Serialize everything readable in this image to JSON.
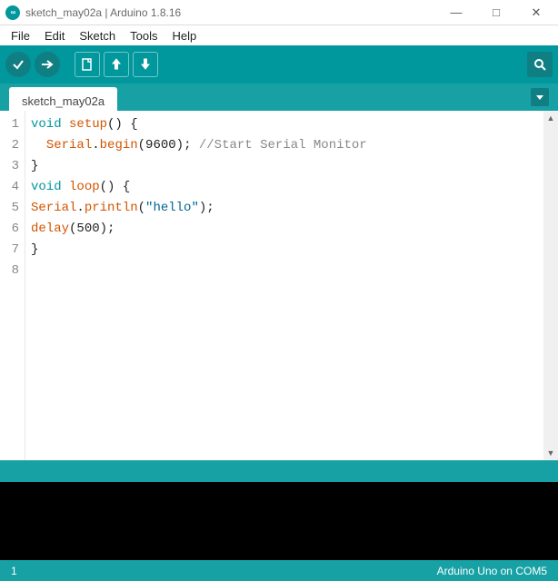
{
  "titlebar": {
    "text": "sketch_may02a | Arduino 1.8.16",
    "icon_text": "∞"
  },
  "window_buttons": {
    "min": "—",
    "max": "□",
    "close": "✕"
  },
  "menubar": [
    "File",
    "Edit",
    "Sketch",
    "Tools",
    "Help"
  ],
  "tab": {
    "label": "sketch_may02a"
  },
  "code": {
    "lines": [
      {
        "n": 1,
        "tokens": [
          {
            "t": "void",
            "c": "kw"
          },
          {
            "t": " "
          },
          {
            "t": "setup",
            "c": "fn"
          },
          {
            "t": "() {"
          }
        ]
      },
      {
        "n": 2,
        "tokens": [
          {
            "t": "  "
          },
          {
            "t": "Serial",
            "c": "fn"
          },
          {
            "t": "."
          },
          {
            "t": "begin",
            "c": "fn"
          },
          {
            "t": "(9600); "
          },
          {
            "t": "//Start Serial Monitor",
            "c": "cm"
          }
        ]
      },
      {
        "n": 3,
        "tokens": [
          {
            "t": "}"
          }
        ]
      },
      {
        "n": 4,
        "tokens": [
          {
            "t": ""
          }
        ]
      },
      {
        "n": 5,
        "tokens": [
          {
            "t": "void",
            "c": "kw"
          },
          {
            "t": " "
          },
          {
            "t": "loop",
            "c": "fn"
          },
          {
            "t": "() {"
          }
        ]
      },
      {
        "n": 6,
        "tokens": [
          {
            "t": "Serial",
            "c": "fn"
          },
          {
            "t": "."
          },
          {
            "t": "println",
            "c": "fn"
          },
          {
            "t": "("
          },
          {
            "t": "\"hello\"",
            "c": "str"
          },
          {
            "t": ");"
          }
        ]
      },
      {
        "n": 7,
        "tokens": [
          {
            "t": "delay",
            "c": "fn"
          },
          {
            "t": "(500);"
          }
        ]
      },
      {
        "n": 8,
        "tokens": [
          {
            "t": "}"
          }
        ]
      }
    ]
  },
  "footer": {
    "left": "1",
    "right": "Arduino Uno on COM5"
  }
}
